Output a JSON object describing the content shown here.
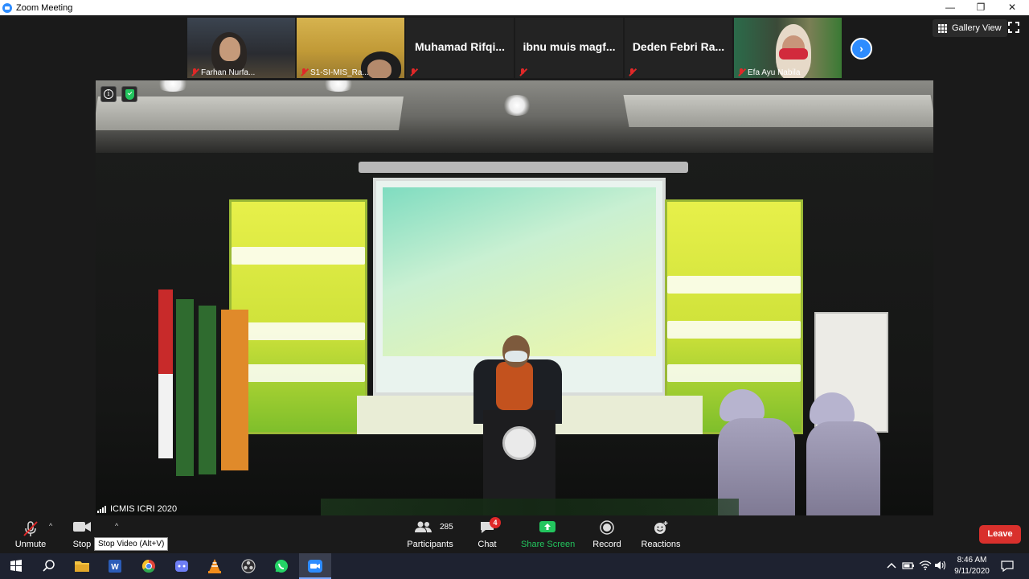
{
  "window": {
    "title": "Zoom Meeting",
    "minimize": "—",
    "restore": "❐",
    "close": "✕"
  },
  "gallery": {
    "tiles": [
      {
        "name": "Farhan Nurfa...",
        "has_video": true,
        "muted": true
      },
      {
        "name": "S1-SI-MIS_Ra...",
        "has_video": true,
        "muted": true
      },
      {
        "name": "Muhamad Rifqi...",
        "has_video": false,
        "muted": true
      },
      {
        "name": "ibnu muis magf...",
        "has_video": false,
        "muted": true
      },
      {
        "name": "Deden Febri Ra...",
        "has_video": false,
        "muted": true
      },
      {
        "name": "Efa Ayu Nabila",
        "has_video": true,
        "muted": true
      }
    ],
    "next_icon": "›",
    "view_label": "Gallery View"
  },
  "stage": {
    "speaker_name": "ICMIS ICRI 2020",
    "info_icon": "i"
  },
  "toolbar": {
    "unmute_label": "Unmute",
    "stop_video_label": "Stop",
    "participants_label": "Participants",
    "participants_count": "285",
    "chat_label": "Chat",
    "chat_badge": "4",
    "share_label": "Share Screen",
    "record_label": "Record",
    "reactions_label": "Reactions",
    "leave_label": "Leave",
    "caret": "^",
    "tooltip": "Stop Video (Alt+V)"
  },
  "taskbar": {
    "time": "8:46 AM",
    "date": "9/11/2020"
  },
  "colors": {
    "accent": "#2d8cff",
    "leave": "#d9302c",
    "muted": "#e02828",
    "share": "#23c55e"
  }
}
